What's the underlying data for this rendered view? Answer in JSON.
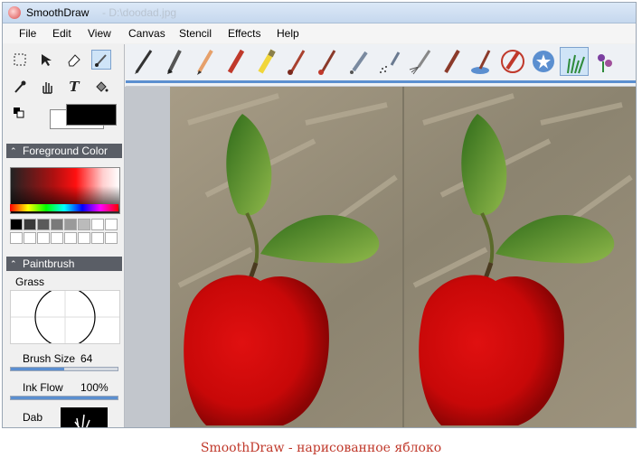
{
  "window": {
    "title": "SmoothDraw",
    "title_ghost": "- D:\\doodad.jpg"
  },
  "menu": [
    "File",
    "Edit",
    "View",
    "Canvas",
    "Stencil",
    "Effects",
    "Help"
  ],
  "tools": [
    "select-rect",
    "move-select",
    "eraser",
    "paintbrush",
    "eyedropper",
    "hand",
    "text",
    "fill"
  ],
  "brushes": [
    "pen",
    "fountain-pen",
    "pencil",
    "crayon",
    "highlighter",
    "paintbrush",
    "round-brush",
    "airbrush",
    "spray",
    "fan-brush",
    "flat-brush",
    "water-brush",
    "marker",
    "stamp",
    "grass",
    "flower"
  ],
  "panel": {
    "foreground_header": "Foreground Color",
    "paintbrush_header": "Paintbrush",
    "brush_name": "Grass",
    "brush_size_label": "Brush Size",
    "brush_size_value": "64",
    "brush_size_fraction": 0.5,
    "ink_flow_label": "Ink Flow",
    "ink_flow_value": "100%",
    "ink_flow_fraction": 1.0,
    "dab_label": "Dab"
  },
  "palette_colors": [
    "#000000",
    "#3a3a3a",
    "#5a5a5a",
    "#7a7a7a",
    "#9a9a9a",
    "#bbbbbb",
    "#ffffff",
    "#ffffff",
    "#ffffff",
    "#ffffff",
    "#ffffff",
    "#ffffff",
    "#ffffff",
    "#ffffff",
    "#ffffff",
    "#ffffff"
  ],
  "colors": {
    "foreground": "#000000",
    "background": "#ffffff",
    "accent": "#5b8fd0"
  },
  "caption": "SmoothDraw - нарисованное яблоко"
}
